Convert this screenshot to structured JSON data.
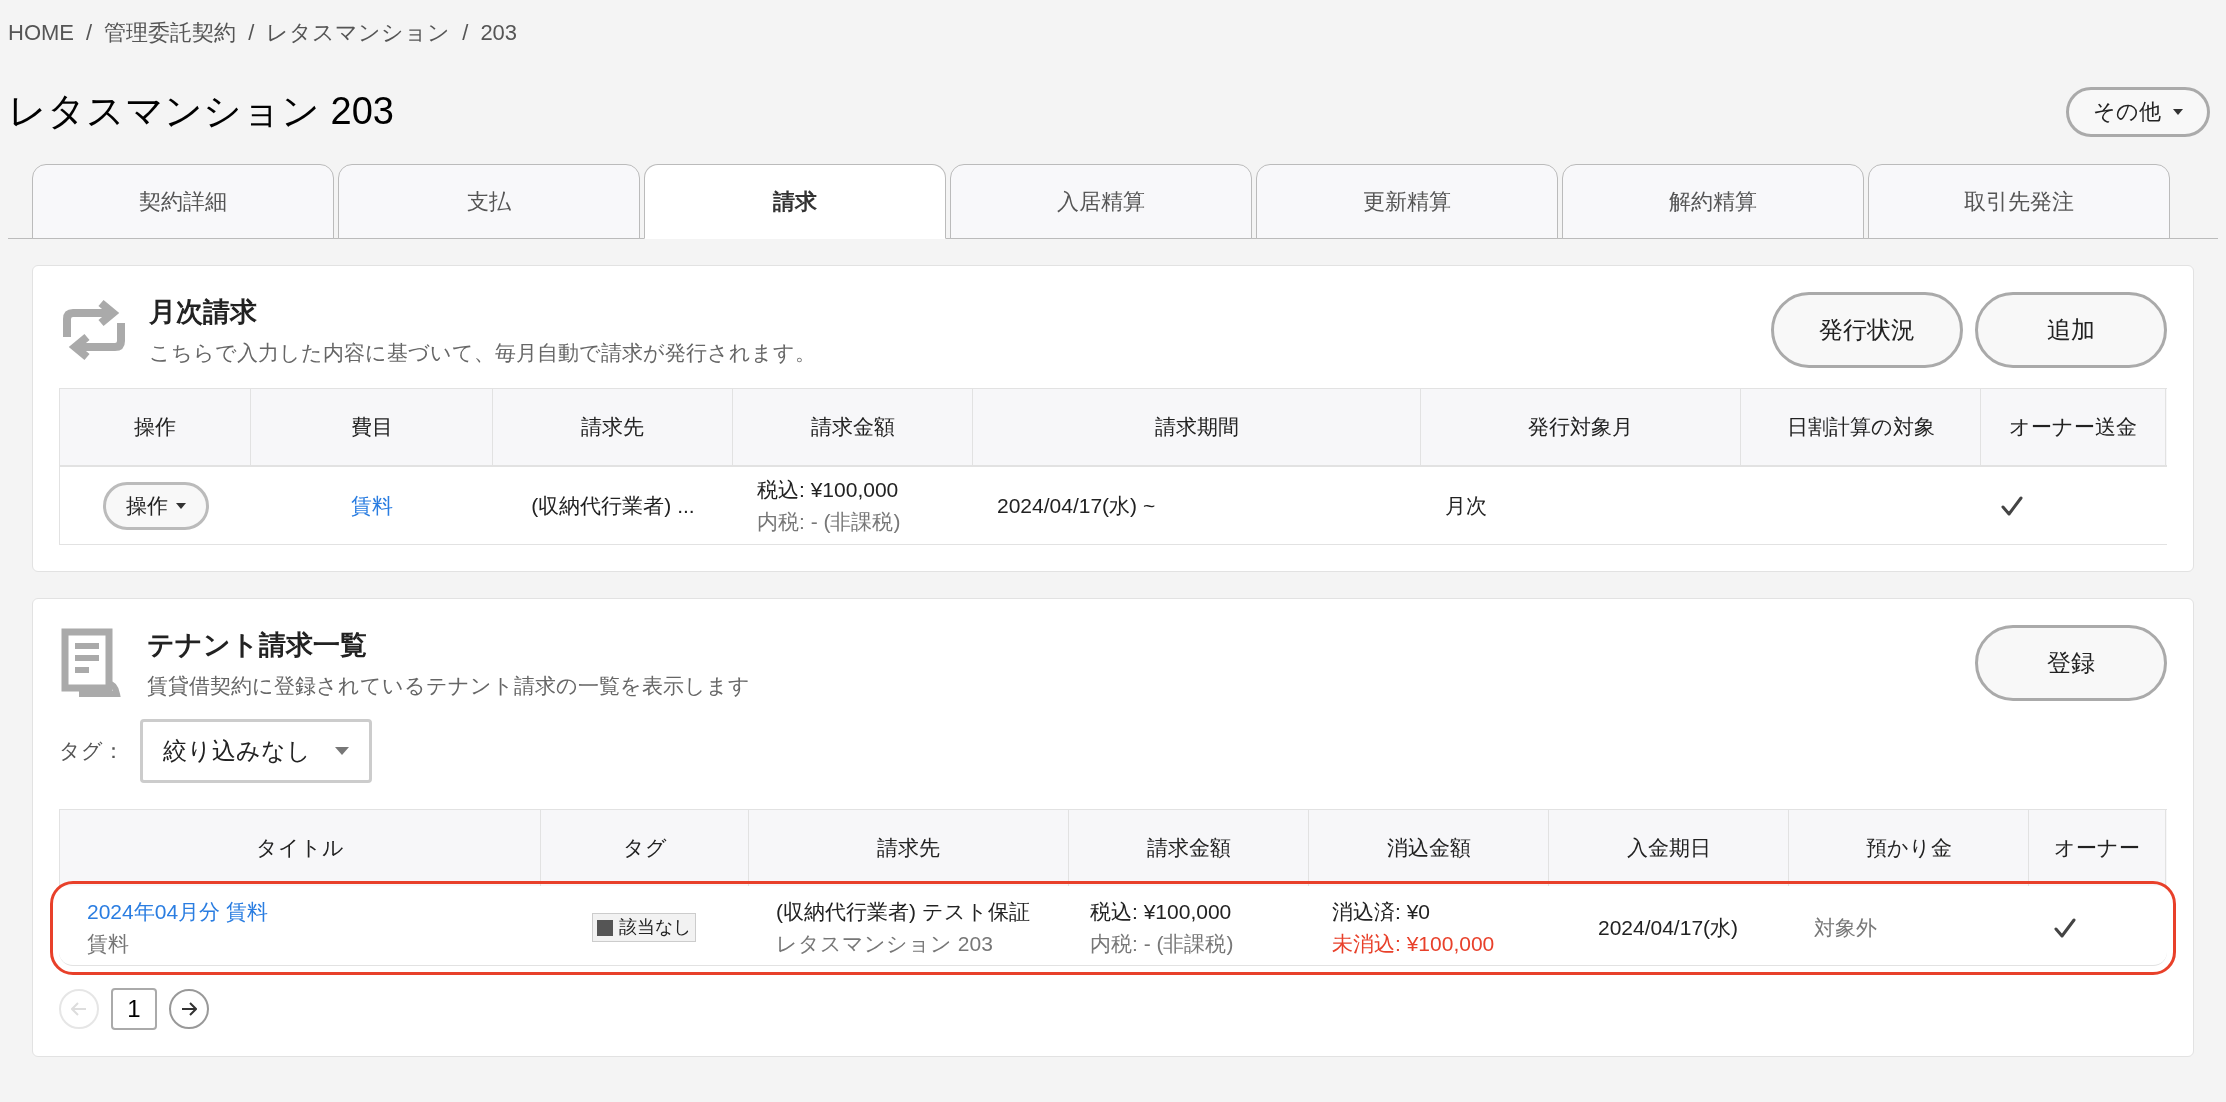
{
  "breadcrumb": [
    "HOME",
    "管理委託契約",
    "レタスマンション",
    "203"
  ],
  "breadcrumb_separator": "/",
  "title": "レタスマンション 203",
  "more_button": "その他",
  "tabs": [
    {
      "label": "契約詳細",
      "selected": false
    },
    {
      "label": "支払",
      "selected": false
    },
    {
      "label": "請求",
      "selected": true
    },
    {
      "label": "入居精算",
      "selected": false
    },
    {
      "label": "更新精算",
      "selected": false
    },
    {
      "label": "解約精算",
      "selected": false
    },
    {
      "label": "取引先発注",
      "selected": false
    }
  ],
  "monthly": {
    "title": "月次請求",
    "description": "こちらで入力した内容に基づいて、毎月自動で請求が発行されます。",
    "buttons": [
      "発行状況",
      "追加"
    ],
    "columns": [
      "操作",
      "費目",
      "請求先",
      "請求金額",
      "請求期間",
      "発行対象月",
      "日割計算の対象",
      "オーナー送金"
    ],
    "rows": [
      {
        "action": "操作",
        "item": "賃料",
        "payee": "(収納代行業者) ...",
        "amount_incl": "税込: ¥100,000",
        "amount_tax": "内税: - (非課税)",
        "period": "2024/04/17(水) ~",
        "issue_month": "月次",
        "prorated": false,
        "owner_remit": true
      }
    ]
  },
  "tenant": {
    "title": "テナント請求一覧",
    "description": "賃貸借契約に登録されているテナント請求の一覧を表示します",
    "button": "登録",
    "filter_label": "タグ：",
    "filter_value": "絞り込みなし",
    "columns": [
      "タイトル",
      "タグ",
      "請求先",
      "請求金額",
      "消込金額",
      "入金期日",
      "預かり金",
      "オーナー"
    ],
    "rows": [
      {
        "highlighted": true,
        "title": "2024年04月分 賃料",
        "title_sub": "賃料",
        "tag": {
          "label": "該当なし",
          "color": "#555555"
        },
        "payee": "(収納代行業者) テスト保証",
        "payee_sub": "レタスマンション 203",
        "amount_incl": "税込: ¥100,000",
        "amount_tax": "内税: - (非課税)",
        "cleared": "消込済: ¥0",
        "uncleared": "未消込: ¥100,000",
        "due_date": "2024/04/17(水)",
        "deposit": "対象外",
        "owner": true
      }
    ],
    "pagination": {
      "prev_disabled": true,
      "pages": [
        {
          "label": "1",
          "selected": true
        }
      ],
      "next_disabled": false
    }
  }
}
